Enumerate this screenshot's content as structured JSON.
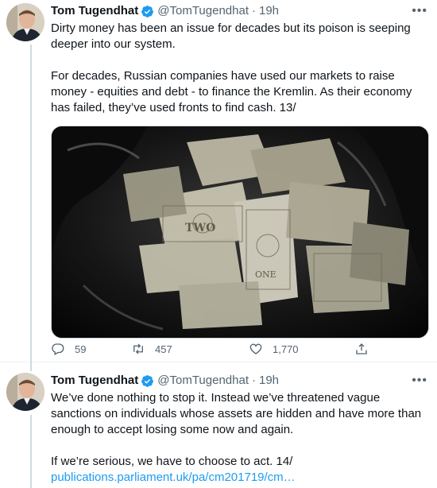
{
  "tweets": [
    {
      "author": {
        "name": "Tom Tugendhat",
        "handle": "@TomTugendhat",
        "verified": true
      },
      "time": "19h",
      "more_icon": "ellipsis-icon",
      "paragraphs": [
        "Dirty money has been an issue for decades but its poison is seeping deeper into our system.",
        "For decades, Russian companies have used our markets to raise money - equities and debt - to finance the Kremlin. As their economy has failed, they’ve used fronts to find cash. 13/"
      ],
      "media": {
        "description_icon": "photo-money-in-bin-bag"
      },
      "stats": {
        "replies": "59",
        "retweets": "457",
        "likes": "1,770"
      }
    },
    {
      "author": {
        "name": "Tom Tugendhat",
        "handle": "@TomTugendhat",
        "verified": true
      },
      "time": "19h",
      "more_icon": "ellipsis-icon",
      "paragraphs": [
        "We’ve done nothing to stop it. Instead we’ve threatened vague sanctions on individuals whose assets are hidden and have more than enough to accept losing some now and again.",
        "If we’re serious, we have to choose to act. 14/"
      ],
      "link": "publications.parliament.uk/pa/cm201719/cm…"
    }
  ],
  "colors": {
    "accent": "#1d9bf0",
    "text": "#0f1419",
    "muted": "#536471",
    "border": "#cfd9de"
  }
}
